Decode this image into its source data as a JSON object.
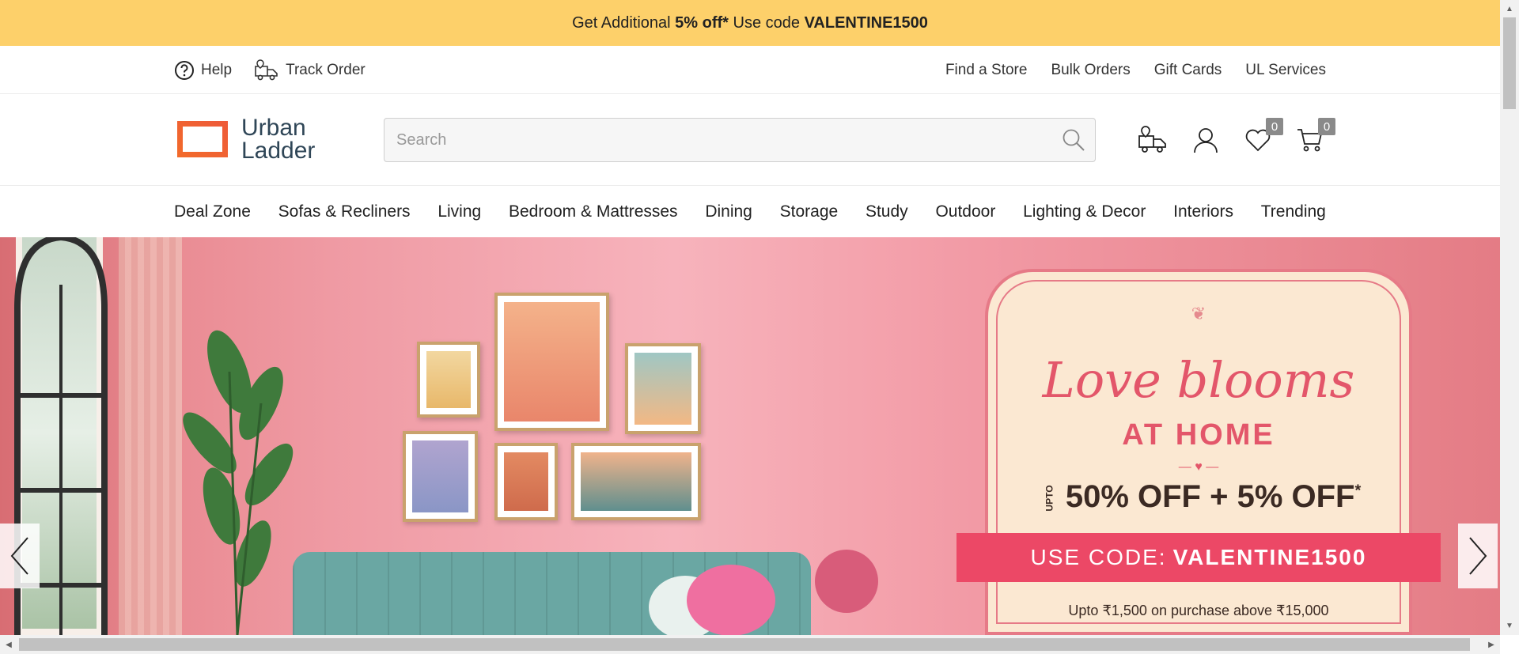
{
  "promo_bar": {
    "text_prefix": "Get Additional",
    "highlight": "5% off*",
    "text_mid": "Use code",
    "code": "VALENTINE1500"
  },
  "util_bar": {
    "help_label": "Help",
    "track_label": "Track Order",
    "links": [
      "Find a Store",
      "Bulk Orders",
      "Gift Cards",
      "UL Services"
    ]
  },
  "header": {
    "logo_line1": "Urban",
    "logo_line2": "Ladder",
    "search_placeholder": "Search",
    "search_value": "",
    "wishlist_count": "0",
    "cart_count": "0"
  },
  "nav": {
    "items": [
      "Deal Zone",
      "Sofas & Recliners",
      "Living",
      "Bedroom & Mattresses",
      "Dining",
      "Storage",
      "Study",
      "Outdoor",
      "Lighting & Decor",
      "Interiors",
      "Trending"
    ]
  },
  "hero": {
    "headline": "Love blooms",
    "subhead": "AT HOME",
    "offer_prefix": "UPTO",
    "offer": "50% OFF + 5% OFF",
    "offer_asterisk": "*",
    "code_label": "USE CODE:",
    "code": "VALENTINE1500",
    "fine_print": "Upto ₹1,500 on purchase above ₹15,000"
  },
  "colors": {
    "promo_bg": "#fdd06a",
    "brand_orange": "#f0742b",
    "brand_text": "#2f4657",
    "hero_pink": "#f29aa5",
    "ribbon": "#ec4866"
  },
  "icons": {
    "help": "help-circle-icon",
    "track": "truck-icon",
    "search": "search-icon",
    "delivery": "delivery-pin-icon",
    "account": "user-icon",
    "wishlist": "heart-icon",
    "cart": "cart-icon",
    "prev": "chevron-left-icon",
    "next": "chevron-right-icon"
  }
}
